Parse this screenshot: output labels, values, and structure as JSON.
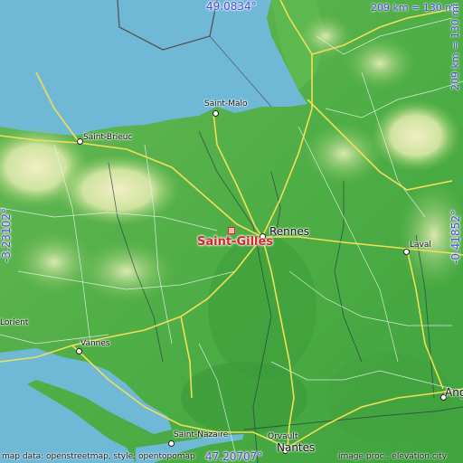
{
  "map": {
    "focus_city": "Saint-Gilles",
    "coords": {
      "north": "49.0834°",
      "south": "47.20707°",
      "west": "-3.23102°",
      "east": "-0.41852°"
    },
    "scale": {
      "horizontal": "209 km = 130 mi",
      "vertical": "209 km = 130 mi"
    },
    "cities": [
      {
        "name": "Saint-Malo"
      },
      {
        "name": "Saint-Brieuc"
      },
      {
        "name": "Rennes"
      },
      {
        "name": "Laval"
      },
      {
        "name": "Vannes"
      },
      {
        "name": "Saint-Nazaire"
      },
      {
        "name": "Nantes"
      },
      {
        "name": "Orvault"
      },
      {
        "name": "Angers"
      },
      {
        "name": "Lorient"
      }
    ],
    "attribution": {
      "left": "map data: openstreetmap, style: opentopomap",
      "right": "image proc.: elevation.city"
    },
    "colors": {
      "water": "#6fb8d6",
      "lowland": "#4fae46",
      "hills": "#a7cf7b",
      "roads": "#f2df55",
      "focus": "#d9262b",
      "coords": "#4b4bd8"
    }
  }
}
